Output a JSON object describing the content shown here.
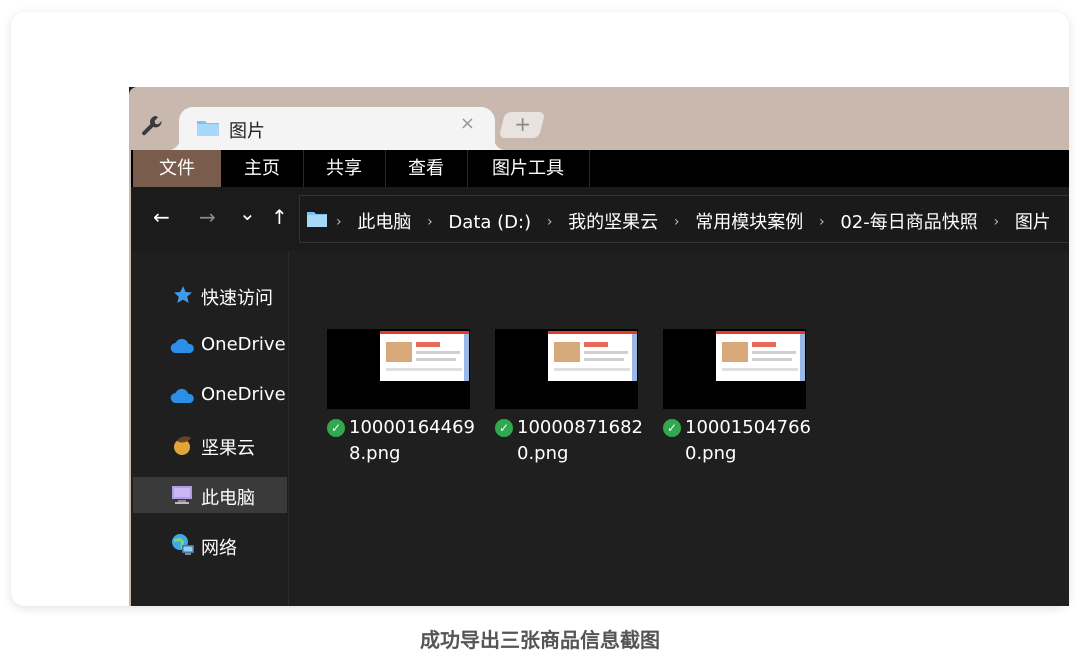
{
  "tab": {
    "title": "图片",
    "close": "×",
    "new_tab": "+"
  },
  "ribbon": {
    "items": [
      "文件",
      "主页",
      "共享",
      "查看",
      "图片工具"
    ]
  },
  "nav": {
    "back": "←",
    "forward": "→",
    "recent": "⌄",
    "up": "↑"
  },
  "address": {
    "crumbs": [
      "此电脑",
      "Data (D:)",
      "我的坚果云",
      "常用模块案例",
      "02-每日商品快照",
      "图片"
    ],
    "separator": "›"
  },
  "sidebar": {
    "items": [
      {
        "label": "快速访问",
        "icon": "star-icon"
      },
      {
        "label": "OneDrive",
        "icon": "cloud-icon"
      },
      {
        "label": "OneDrive",
        "icon": "cloud-icon"
      },
      {
        "label": "坚果云",
        "icon": "acorn-icon"
      },
      {
        "label": "此电脑",
        "icon": "monitor-icon",
        "selected": true
      },
      {
        "label": "网络",
        "icon": "network-icon"
      }
    ]
  },
  "files": [
    {
      "name": "100001644698.png",
      "status": "synced"
    },
    {
      "name": "100008716820.png",
      "status": "synced"
    },
    {
      "name": "100015047660.png",
      "status": "synced"
    }
  ],
  "caption": "成功导出三张商品信息截图",
  "colors": {
    "tabbar": "#c8b8ae",
    "ribbon_active": "#7a5c4c",
    "folder": "#7cc3f2",
    "sync_check": "#2fa84f",
    "onedrive": "#2b8ee8"
  }
}
